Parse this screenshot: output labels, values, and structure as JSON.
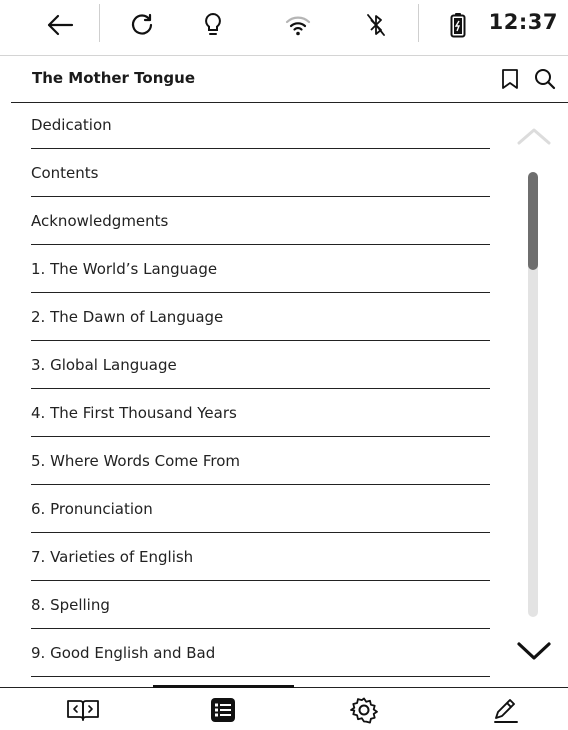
{
  "status_bar": {
    "icons": [
      "back-arrow-icon",
      "refresh-icon",
      "lightbulb-icon",
      "wifi-icon",
      "bluetooth-off-icon",
      "battery-charging-icon"
    ],
    "time": "12:37"
  },
  "header": {
    "title": "The Mother Tongue",
    "icons": [
      "bookmark-icon",
      "search-icon"
    ]
  },
  "toc": {
    "items": [
      {
        "label": "Dedication"
      },
      {
        "label": "Contents"
      },
      {
        "label": "Acknowledgments"
      },
      {
        "label": "1. The World’s Language"
      },
      {
        "label": "2. The Dawn of Language"
      },
      {
        "label": "3. Global Language"
      },
      {
        "label": "4. The First Thousand Years"
      },
      {
        "label": "5. Where Words Come From"
      },
      {
        "label": "6. Pronunciation"
      },
      {
        "label": "7. Varieties of English"
      },
      {
        "label": "8. Spelling"
      },
      {
        "label": "9. Good English and Bad"
      }
    ]
  },
  "scroll": {
    "position_fraction": 0.0,
    "thumb_fraction": 0.22
  },
  "bottom_tabs": {
    "items": [
      "open-book-icon",
      "contents-list-icon",
      "settings-gear-icon",
      "annotate-pen-icon"
    ],
    "active_index": 1
  }
}
